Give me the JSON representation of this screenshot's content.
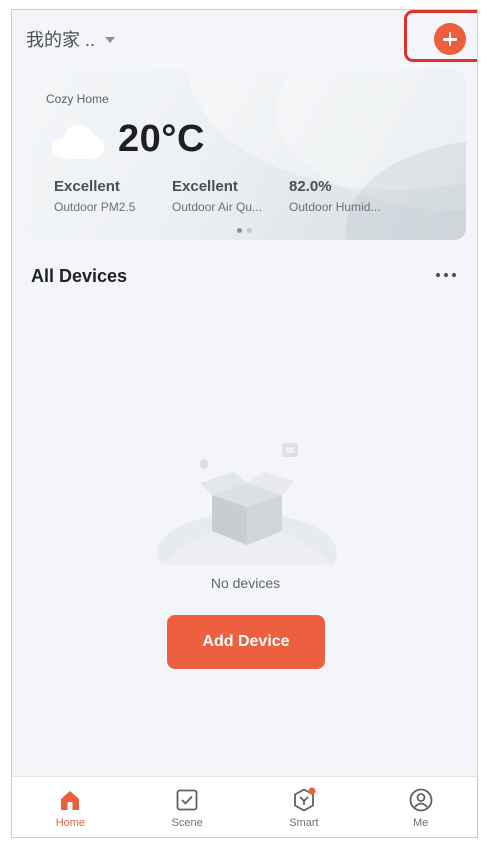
{
  "header": {
    "home_name": "我的家 ..",
    "add_icon": "plus-circle-icon"
  },
  "weather": {
    "home_label": "Cozy Home",
    "temperature": "20°C",
    "icon": "cloud-icon",
    "stats": [
      {
        "value": "Excellent",
        "label": "Outdoor PM2.5"
      },
      {
        "value": "Excellent",
        "label": "Outdoor Air Qu..."
      },
      {
        "value": "82.0%",
        "label": "Outdoor Humid..."
      }
    ],
    "page_index": 1,
    "page_count": 2
  },
  "devices": {
    "title": "All Devices",
    "empty_text": "No devices",
    "add_button": "Add Device"
  },
  "tabs": [
    {
      "label": "Home",
      "icon": "home-icon",
      "active": true
    },
    {
      "label": "Scene",
      "icon": "scene-check-icon",
      "active": false
    },
    {
      "label": "Smart",
      "icon": "smart-icon",
      "active": false
    },
    {
      "label": "Me",
      "icon": "user-icon",
      "active": false
    }
  ],
  "colors": {
    "accent": "#ec5e3e",
    "highlight": "#e0302a"
  }
}
